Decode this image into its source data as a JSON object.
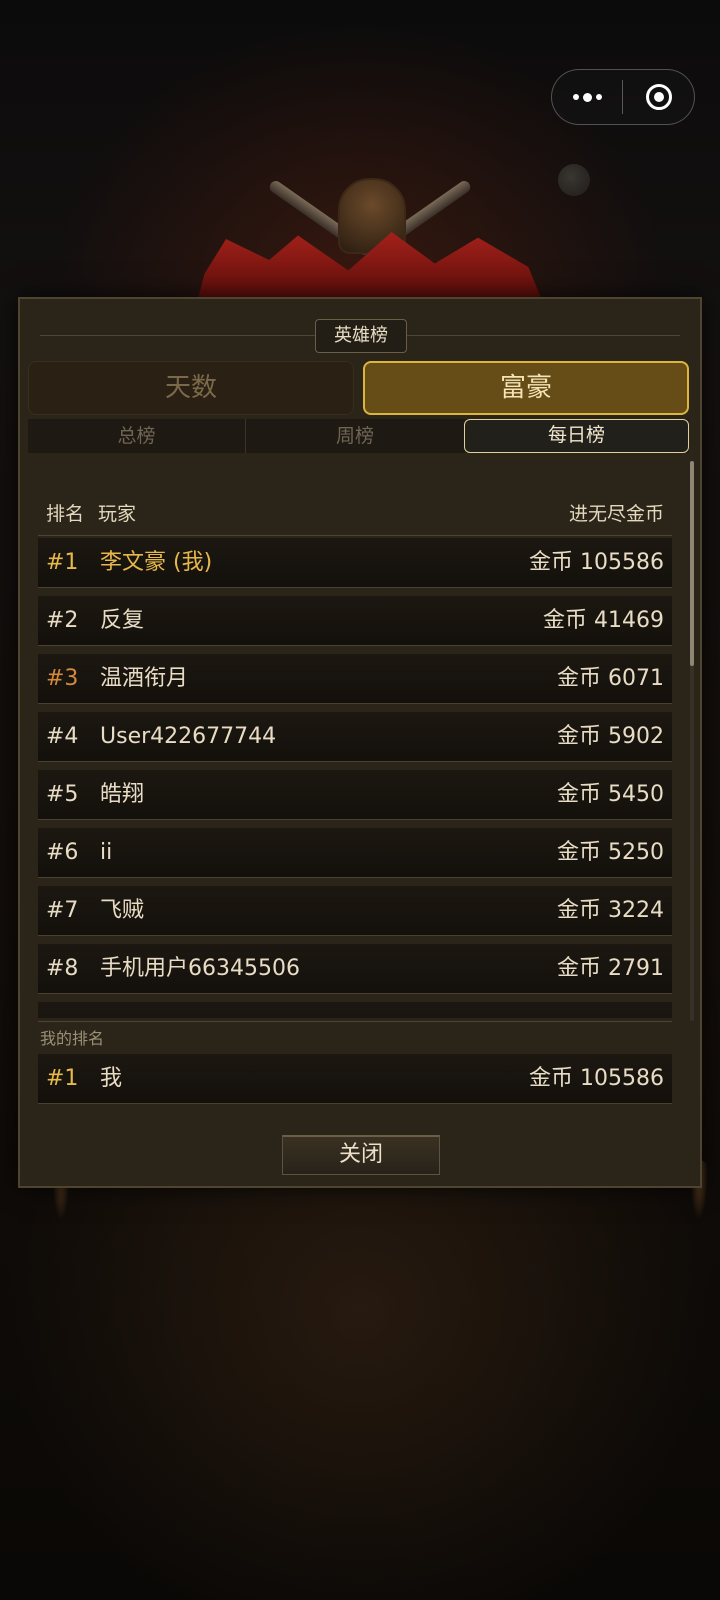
{
  "window": {
    "capsule_more": "more-dots",
    "capsule_close": "target-circle"
  },
  "dialog": {
    "title": "英雄榜",
    "main_tabs": [
      {
        "label": "天数",
        "active": false
      },
      {
        "label": "富豪",
        "active": true
      }
    ],
    "sub_tabs": [
      {
        "label": "总榜",
        "active": false
      },
      {
        "label": "周榜",
        "active": false
      },
      {
        "label": "每日榜",
        "active": true
      }
    ],
    "columns": {
      "rank": "排名",
      "player": "玩家",
      "gold": "进无尽金币"
    },
    "rows": [
      {
        "rank": "#1",
        "name": "李文豪 (我)",
        "gold": "金币 105586"
      },
      {
        "rank": "#2",
        "name": "反复",
        "gold": "金币 41469"
      },
      {
        "rank": "#3",
        "name": "温酒衔月",
        "gold": "金币 6071"
      },
      {
        "rank": "#4",
        "name": "User422677744",
        "gold": "金币 5902"
      },
      {
        "rank": "#5",
        "name": "皓翔",
        "gold": "金币 5450"
      },
      {
        "rank": "#6",
        "name": "ii",
        "gold": "金币 5250"
      },
      {
        "rank": "#7",
        "name": "飞贼",
        "gold": "金币 3224"
      },
      {
        "rank": "#8",
        "name": "手机用户66345506",
        "gold": "金币 2791"
      },
      {
        "rank": "",
        "name": "",
        "gold": ""
      }
    ],
    "my_rank_label": "我的排名",
    "my_rank": {
      "rank": "#1",
      "name": "我",
      "gold": "金币 105586"
    },
    "close_label": "关闭"
  },
  "colors": {
    "accent_gold": "#ddb53a",
    "rank1": "#e7b84a",
    "rank3": "#d48a3d",
    "panel": "#2a2419"
  }
}
